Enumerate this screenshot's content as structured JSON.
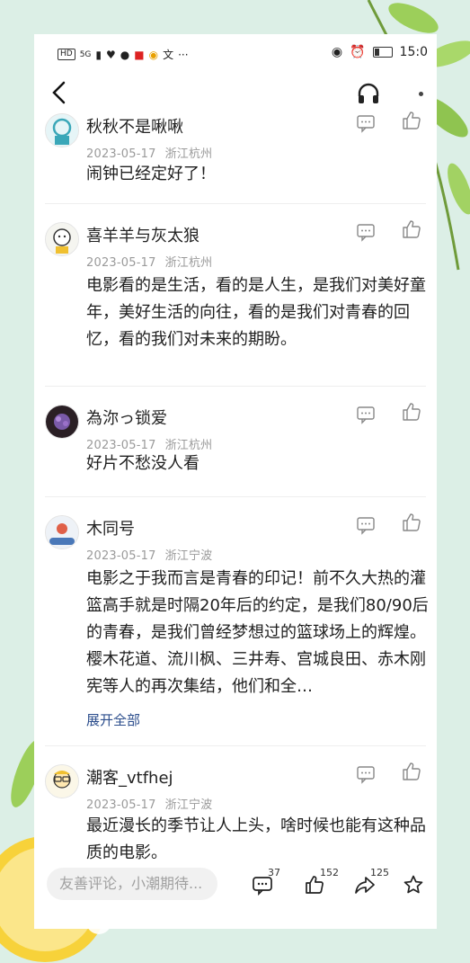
{
  "status": {
    "left_chip": "HD",
    "signal": "5G",
    "time": "15:0"
  },
  "header": {
    "back_icon": "chevron-left-icon",
    "listen_icon": "headphones-icon"
  },
  "comments": [
    {
      "username": "秋秋不是啾啾",
      "date": "2023-05-17",
      "location": "浙江杭州",
      "text": "闹钟已经定好了！"
    },
    {
      "username": "喜羊羊与灰太狼",
      "date": "2023-05-17",
      "location": "浙江杭州",
      "text": "电影看的是生活，看的是人生，是我们对美好童年，美好生活的向往，看的是我们对青春的回忆，看的我们对未来的期盼。"
    },
    {
      "username": "為沵っ锁爱",
      "date": "2023-05-17",
      "location": "浙江杭州",
      "text": "好片不愁没人看"
    },
    {
      "username": "木同号",
      "date": "2023-05-17",
      "location": "浙江宁波",
      "text": "电影之于我而言是青春的印记！前不久大热的灌篮高手就是时隔20年后的约定，是我们80/90后的青春，是我们曾经梦想过的篮球场上的辉煌。樱木花道、流川枫、三井寿、宫城良田、赤木刚宪等人的再次集结，他们和全…",
      "expand_label": "展开全部"
    },
    {
      "username": "潮客_vtfhej",
      "date": "2023-05-17",
      "location": "浙江宁波",
      "text": "最近漫长的季节让人上头，啥时候也能有这种品质的电影。"
    }
  ],
  "bottom_bar": {
    "input_placeholder": "友善评论，小潮期待...",
    "comment_count": "37",
    "like_count": "152",
    "share_count": "125"
  },
  "colors": {
    "background": "#dcefe6",
    "link": "#2b4d8c",
    "meta": "#9a9a9a"
  }
}
